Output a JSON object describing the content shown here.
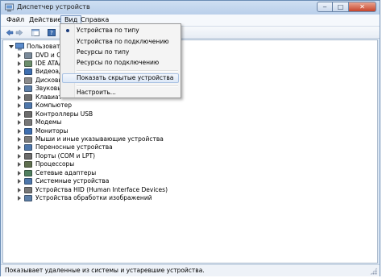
{
  "window": {
    "title": "Диспетчер устройств",
    "controls": {
      "minimize": "‒",
      "maximize": "□",
      "close": "✕"
    }
  },
  "menubar": {
    "items": [
      "Файл",
      "Действие",
      "Вид",
      "Справка"
    ],
    "open_index": 2
  },
  "dropdown": {
    "items": [
      {
        "label": "Устройства по типу",
        "checked": true
      },
      {
        "label": "Устройства по подключению"
      },
      {
        "label": "Ресурсы по типу"
      },
      {
        "label": "Ресурсы по подключению"
      },
      {
        "label": "Показать скрытые устройства",
        "highlighted": true
      },
      {
        "label": "Настроить..."
      }
    ]
  },
  "tree": {
    "root": "Пользователь-ПК",
    "items": [
      {
        "label": "DVD и CD-ROM дисководы",
        "visible": "DVD и CD",
        "icon_color": "#7a8a9a"
      },
      {
        "label": "IDE ATA/ATAPI контроллеры",
        "visible": "IDE ATA/",
        "icon_color": "#6c8e6c"
      },
      {
        "label": "Видеоадаптеры",
        "visible": "Видеоад",
        "icon_color": "#3f6fb0"
      },
      {
        "label": "Дисковые устройства",
        "visible": "Дисковы",
        "icon_color": "#8a8a8a"
      },
      {
        "label": "Звуковые устройства",
        "visible": "Звуковы",
        "icon_color": "#5d7fa8"
      },
      {
        "label": "Клавиатуры",
        "visible": "Клавиат",
        "icon_color": "#6f6f6f"
      },
      {
        "label": "Компьютер",
        "icon_color": "#4e77ab"
      },
      {
        "label": "Контроллеры USB",
        "icon_color": "#6b6b6b"
      },
      {
        "label": "Модемы",
        "icon_color": "#777777"
      },
      {
        "label": "Мониторы",
        "icon_color": "#3f6fb0"
      },
      {
        "label": "Мыши и иные указывающие устройства",
        "icon_color": "#7b7b7b"
      },
      {
        "label": "Переносные устройства",
        "icon_color": "#4e77ab"
      },
      {
        "label": "Порты (COM и LPT)",
        "icon_color": "#6b6b6b"
      },
      {
        "label": "Процессоры",
        "icon_color": "#5f6f4f"
      },
      {
        "label": "Сетевые адаптеры",
        "icon_color": "#4f7f5f"
      },
      {
        "label": "Системные устройства",
        "icon_color": "#4e77ab"
      },
      {
        "label": "Устройства HID (Human Interface Devices)",
        "icon_color": "#777777"
      },
      {
        "label": "Устройства обработки изображений",
        "icon_color": "#5d7fa8"
      }
    ]
  },
  "status": {
    "text": "Показывает удаленные из системы и устаревшие устройства."
  }
}
